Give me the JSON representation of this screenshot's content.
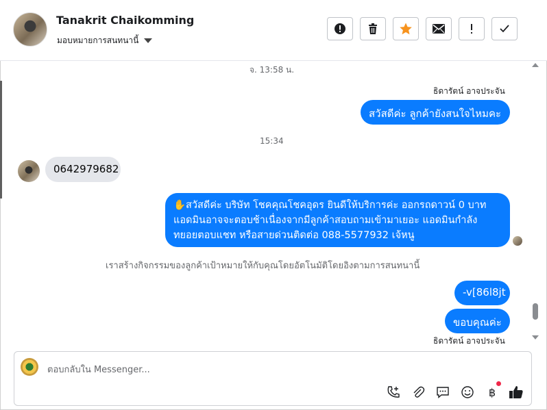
{
  "header": {
    "contact_name": "Tanakrit Chaikomming",
    "assign_label": "มอบหมายการสนทนานี้",
    "toolbar": [
      {
        "name": "spam-button",
        "icon": "alert-circle-icon"
      },
      {
        "name": "delete-button",
        "icon": "trash-icon"
      },
      {
        "name": "star-button",
        "icon": "star-icon"
      },
      {
        "name": "mark-unread-button",
        "icon": "envelope-icon"
      },
      {
        "name": "follow-up-button",
        "icon": "exclamation-icon"
      },
      {
        "name": "mark-done-button",
        "icon": "check-icon"
      }
    ],
    "star_color": "#f7931e"
  },
  "messages": {
    "time1": "จ. 13:58 น.",
    "sender1": "ธิดารัตน์ อาจประจัน",
    "out1": "สวัสดีค่ะ ลูกค้ายังสนใจไหมคะ",
    "time2": "15:34",
    "in1": "0642979682",
    "out2_line1": "✋สวัสดีค่ะ บริษัท โชคคุณโชคอุดร ยินดีให้บริการค่ะ ออกรถดาวน์ 0 บาท",
    "out2_line2": "แอดมินอาจจะตอบช้าเนื่องจากมีลูกค้าสอบถามเข้ามาเยอะ แอดมินกำลัง",
    "out2_line3": "ทยอยตอบแชท หรือสายด่วนติดต่อ 088-5577932 เจ้หนู",
    "system": "เราสร้างกิจกรรมของลูกค้าเป้าหมายให้กับคุณโดยอัตโนมัติโดยอิงตามการสนทนานี้",
    "out3": "-v[86l8jt",
    "out4": "ขอบคุณค่ะ",
    "sender2": "ธิดารัตน์ อาจประจัน",
    "bubble_color": "#0a7cff"
  },
  "composer": {
    "placeholder": "ตอบกลับใน Messenger...",
    "icons": [
      "phone-plus-icon",
      "paperclip-icon",
      "chat-bubble-icon",
      "emoji-icon",
      "baht-icon",
      "thumbs-up-icon"
    ],
    "badge_color": "#f02849"
  }
}
